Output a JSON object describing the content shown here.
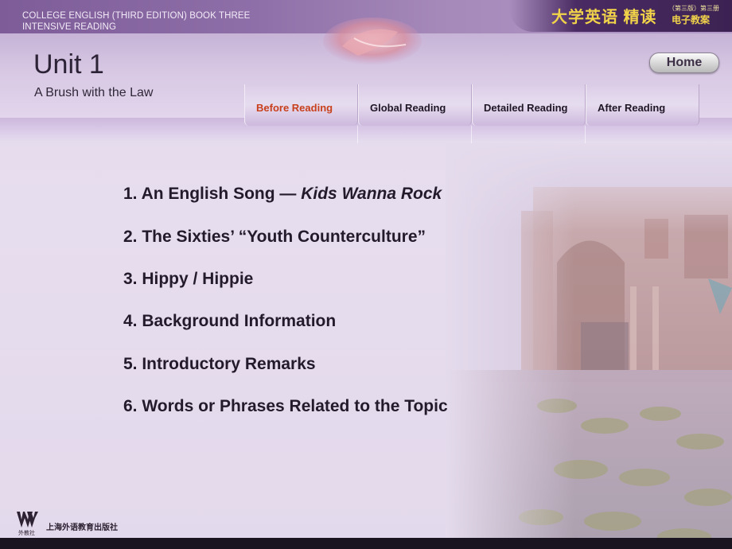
{
  "header": {
    "course_line1": "COLLEGE ENGLISH (THIRD EDITION) BOOK THREE",
    "course_line2": "INTENSIVE READING",
    "cn_logo_main": "大学英语 精读",
    "cn_logo_edition": "（第三版）第三册",
    "cn_logo_sub": "电子教案",
    "unit_title": "Unit 1",
    "unit_subtitle": "A Brush with the Law",
    "home_label": "Home"
  },
  "nav": {
    "tabs": [
      {
        "label": "Before Reading",
        "active": true
      },
      {
        "label": "Global Reading",
        "active": false
      },
      {
        "label": "Detailed Reading",
        "active": false
      },
      {
        "label": "After Reading",
        "active": false
      }
    ]
  },
  "menu": {
    "items": [
      {
        "text": "1. An English Song — ",
        "italic": "Kids Wanna Rock"
      },
      {
        "text": "2. The Sixties’ “Youth Counterculture”",
        "italic": ""
      },
      {
        "text": "3. Hippy / Hippie",
        "italic": ""
      },
      {
        "text": "4. Background Information",
        "italic": ""
      },
      {
        "text": "5. Introductory Remarks",
        "italic": ""
      },
      {
        "text": "6. Words or Phrases Related to the Topic",
        "italic": ""
      }
    ]
  },
  "footer": {
    "publisher_logo_caption": "外教社",
    "publisher_name": "上海外语教育出版社"
  },
  "colors": {
    "active_tab": "#c8401c",
    "logo_gold": "#f1d34a",
    "background": "#e4dbed"
  }
}
